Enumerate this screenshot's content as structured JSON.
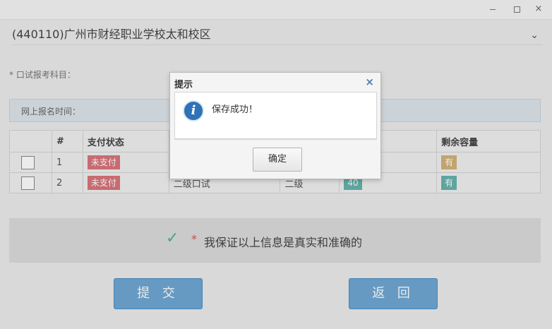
{
  "window": {
    "minimize_icon": "minimize-icon",
    "maximize_icon": "maximize-icon",
    "close_label": "×"
  },
  "campus_select": {
    "value": "(440110)广州市财经职业学校太和校区",
    "chevron": "⌄"
  },
  "form": {
    "oral_subject_label": "* 口试报考科目：",
    "online_time_label": "网上报名时间："
  },
  "table": {
    "headers": [
      "",
      "#",
      "支付状态",
      "",
      "",
      "",
      "剩余容量"
    ],
    "rows": [
      {
        "num": "1",
        "pay_status": "未支付",
        "subject": "",
        "level": "",
        "price": "",
        "capacity": "有"
      },
      {
        "num": "2",
        "pay_status": "未支付",
        "subject": "二级口试",
        "level": "二级",
        "price": "40",
        "capacity": "有"
      }
    ]
  },
  "guarantee": {
    "asterisk": "*",
    "text": "我保证以上信息是真实和准确的"
  },
  "buttons": {
    "submit": "提 交",
    "back": "返 回"
  },
  "dialog": {
    "title": "提示",
    "close": "×",
    "message": "保存成功！",
    "icon_glyph": "i",
    "ok": "确定"
  },
  "colors": {
    "unpaid": "#d9757b",
    "capacity_available_1": "#d2b279",
    "capacity_available_2": "#67b3ac",
    "button_primary": "#6fa8d4",
    "check": "#4bb29b"
  }
}
